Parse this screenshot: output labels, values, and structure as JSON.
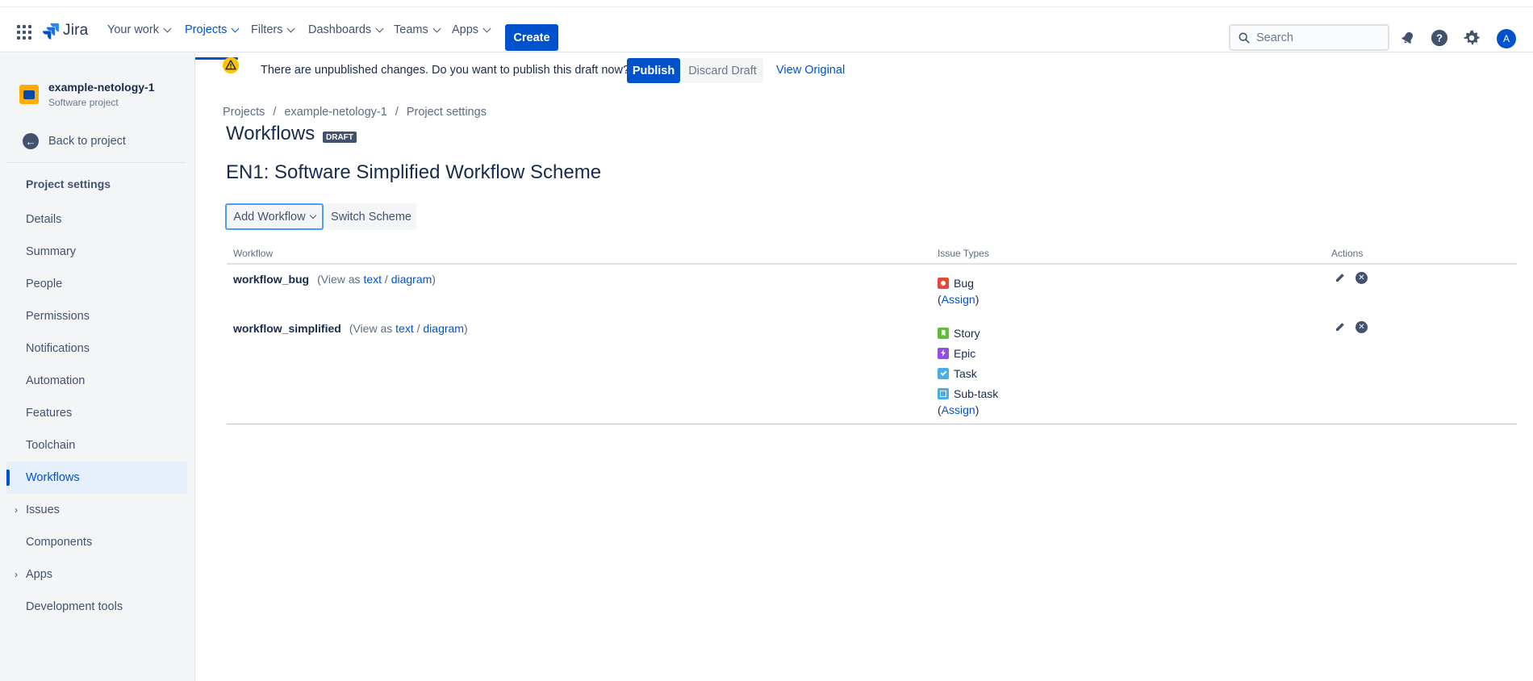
{
  "topnav": {
    "logo_text": "Jira",
    "items": [
      {
        "label": "Your work"
      },
      {
        "label": "Projects"
      },
      {
        "label": "Filters"
      },
      {
        "label": "Dashboards"
      },
      {
        "label": "Teams"
      },
      {
        "label": "Apps"
      }
    ],
    "create_label": "Create",
    "search_placeholder": "Search",
    "avatar_initial": "A"
  },
  "sidebar": {
    "project_name": "example-netology-1",
    "project_type": "Software project",
    "back_label": "Back to project",
    "heading": "Project settings",
    "items": [
      {
        "label": "Details"
      },
      {
        "label": "Summary"
      },
      {
        "label": "People"
      },
      {
        "label": "Permissions"
      },
      {
        "label": "Notifications"
      },
      {
        "label": "Automation"
      },
      {
        "label": "Features"
      },
      {
        "label": "Toolchain"
      },
      {
        "label": "Workflows"
      },
      {
        "label": "Issues"
      },
      {
        "label": "Components"
      },
      {
        "label": "Apps"
      },
      {
        "label": "Development tools"
      }
    ]
  },
  "banner": {
    "message": "There are unpublished changes. Do you want to publish this draft now?",
    "publish_label": "Publish",
    "discard_label": "Discard Draft",
    "view_original_label": "View Original"
  },
  "breadcrumb": [
    "Projects",
    "/",
    "example-netology-1",
    "/",
    "Project settings"
  ],
  "page": {
    "title": "Workflows",
    "badge": "DRAFT",
    "scheme_title": "EN1: Software Simplified Workflow Scheme",
    "add_workflow_label": "Add Workflow",
    "switch_scheme_label": "Switch Scheme"
  },
  "table": {
    "headers": {
      "workflow": "Workflow",
      "issue_types": "Issue Types",
      "actions": "Actions"
    },
    "view_as": "(View as",
    "text_link": "text",
    "slash": "/",
    "diagram_link": "diagram",
    "close_paren": ")",
    "assign_open": "(",
    "assign_link": "Assign",
    "assign_close": ")",
    "rows": [
      {
        "name": "workflow_bug",
        "issue_types": [
          {
            "label": "Bug",
            "color": "#e5493a"
          }
        ]
      },
      {
        "name": "workflow_simplified",
        "issue_types": [
          {
            "label": "Story",
            "color": "#63ba3c"
          },
          {
            "label": "Epic",
            "color": "#904ee2"
          },
          {
            "label": "Task",
            "color": "#4bade8"
          },
          {
            "label": "Sub-task",
            "color": "#4bade8"
          }
        ]
      }
    ]
  },
  "colors": {
    "accent": "#0052cc",
    "sidebar_bg": "#f4f5f7"
  }
}
